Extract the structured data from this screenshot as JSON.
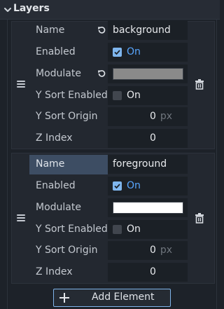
{
  "section": {
    "title": "Layers",
    "expanded": true
  },
  "labels": {
    "name": "Name",
    "enabled": "Enabled",
    "modulate": "Modulate",
    "y_sort_enabled": "Y Sort Enabled",
    "y_sort_origin": "Y Sort Origin",
    "z_index": "Z Index"
  },
  "layers": [
    {
      "name": "background",
      "enabled": true,
      "enabled_text": "On",
      "modulate_color": "#8a8a8a",
      "y_sort_enabled": false,
      "y_sort_enabled_text": "On",
      "y_sort_origin": "0",
      "y_sort_origin_unit": "px",
      "z_index": "0"
    },
    {
      "name": "foreground",
      "enabled": true,
      "enabled_text": "On",
      "modulate_color": "#ffffff",
      "y_sort_enabled": false,
      "y_sort_enabled_text": "On",
      "y_sort_origin": "0",
      "y_sort_origin_unit": "px",
      "z_index": "0"
    }
  ],
  "add_button": {
    "label": "Add Element"
  },
  "icons": {
    "section": "chevron-down-icon",
    "revert": "revert-icon",
    "drag": "drag-handle-icon",
    "delete": "trash-icon",
    "add": "plus-icon"
  },
  "colors": {
    "accent": "#58a6ff",
    "checkbox_checked": "#7fb6ee",
    "selected_row": "#3d4d63"
  }
}
